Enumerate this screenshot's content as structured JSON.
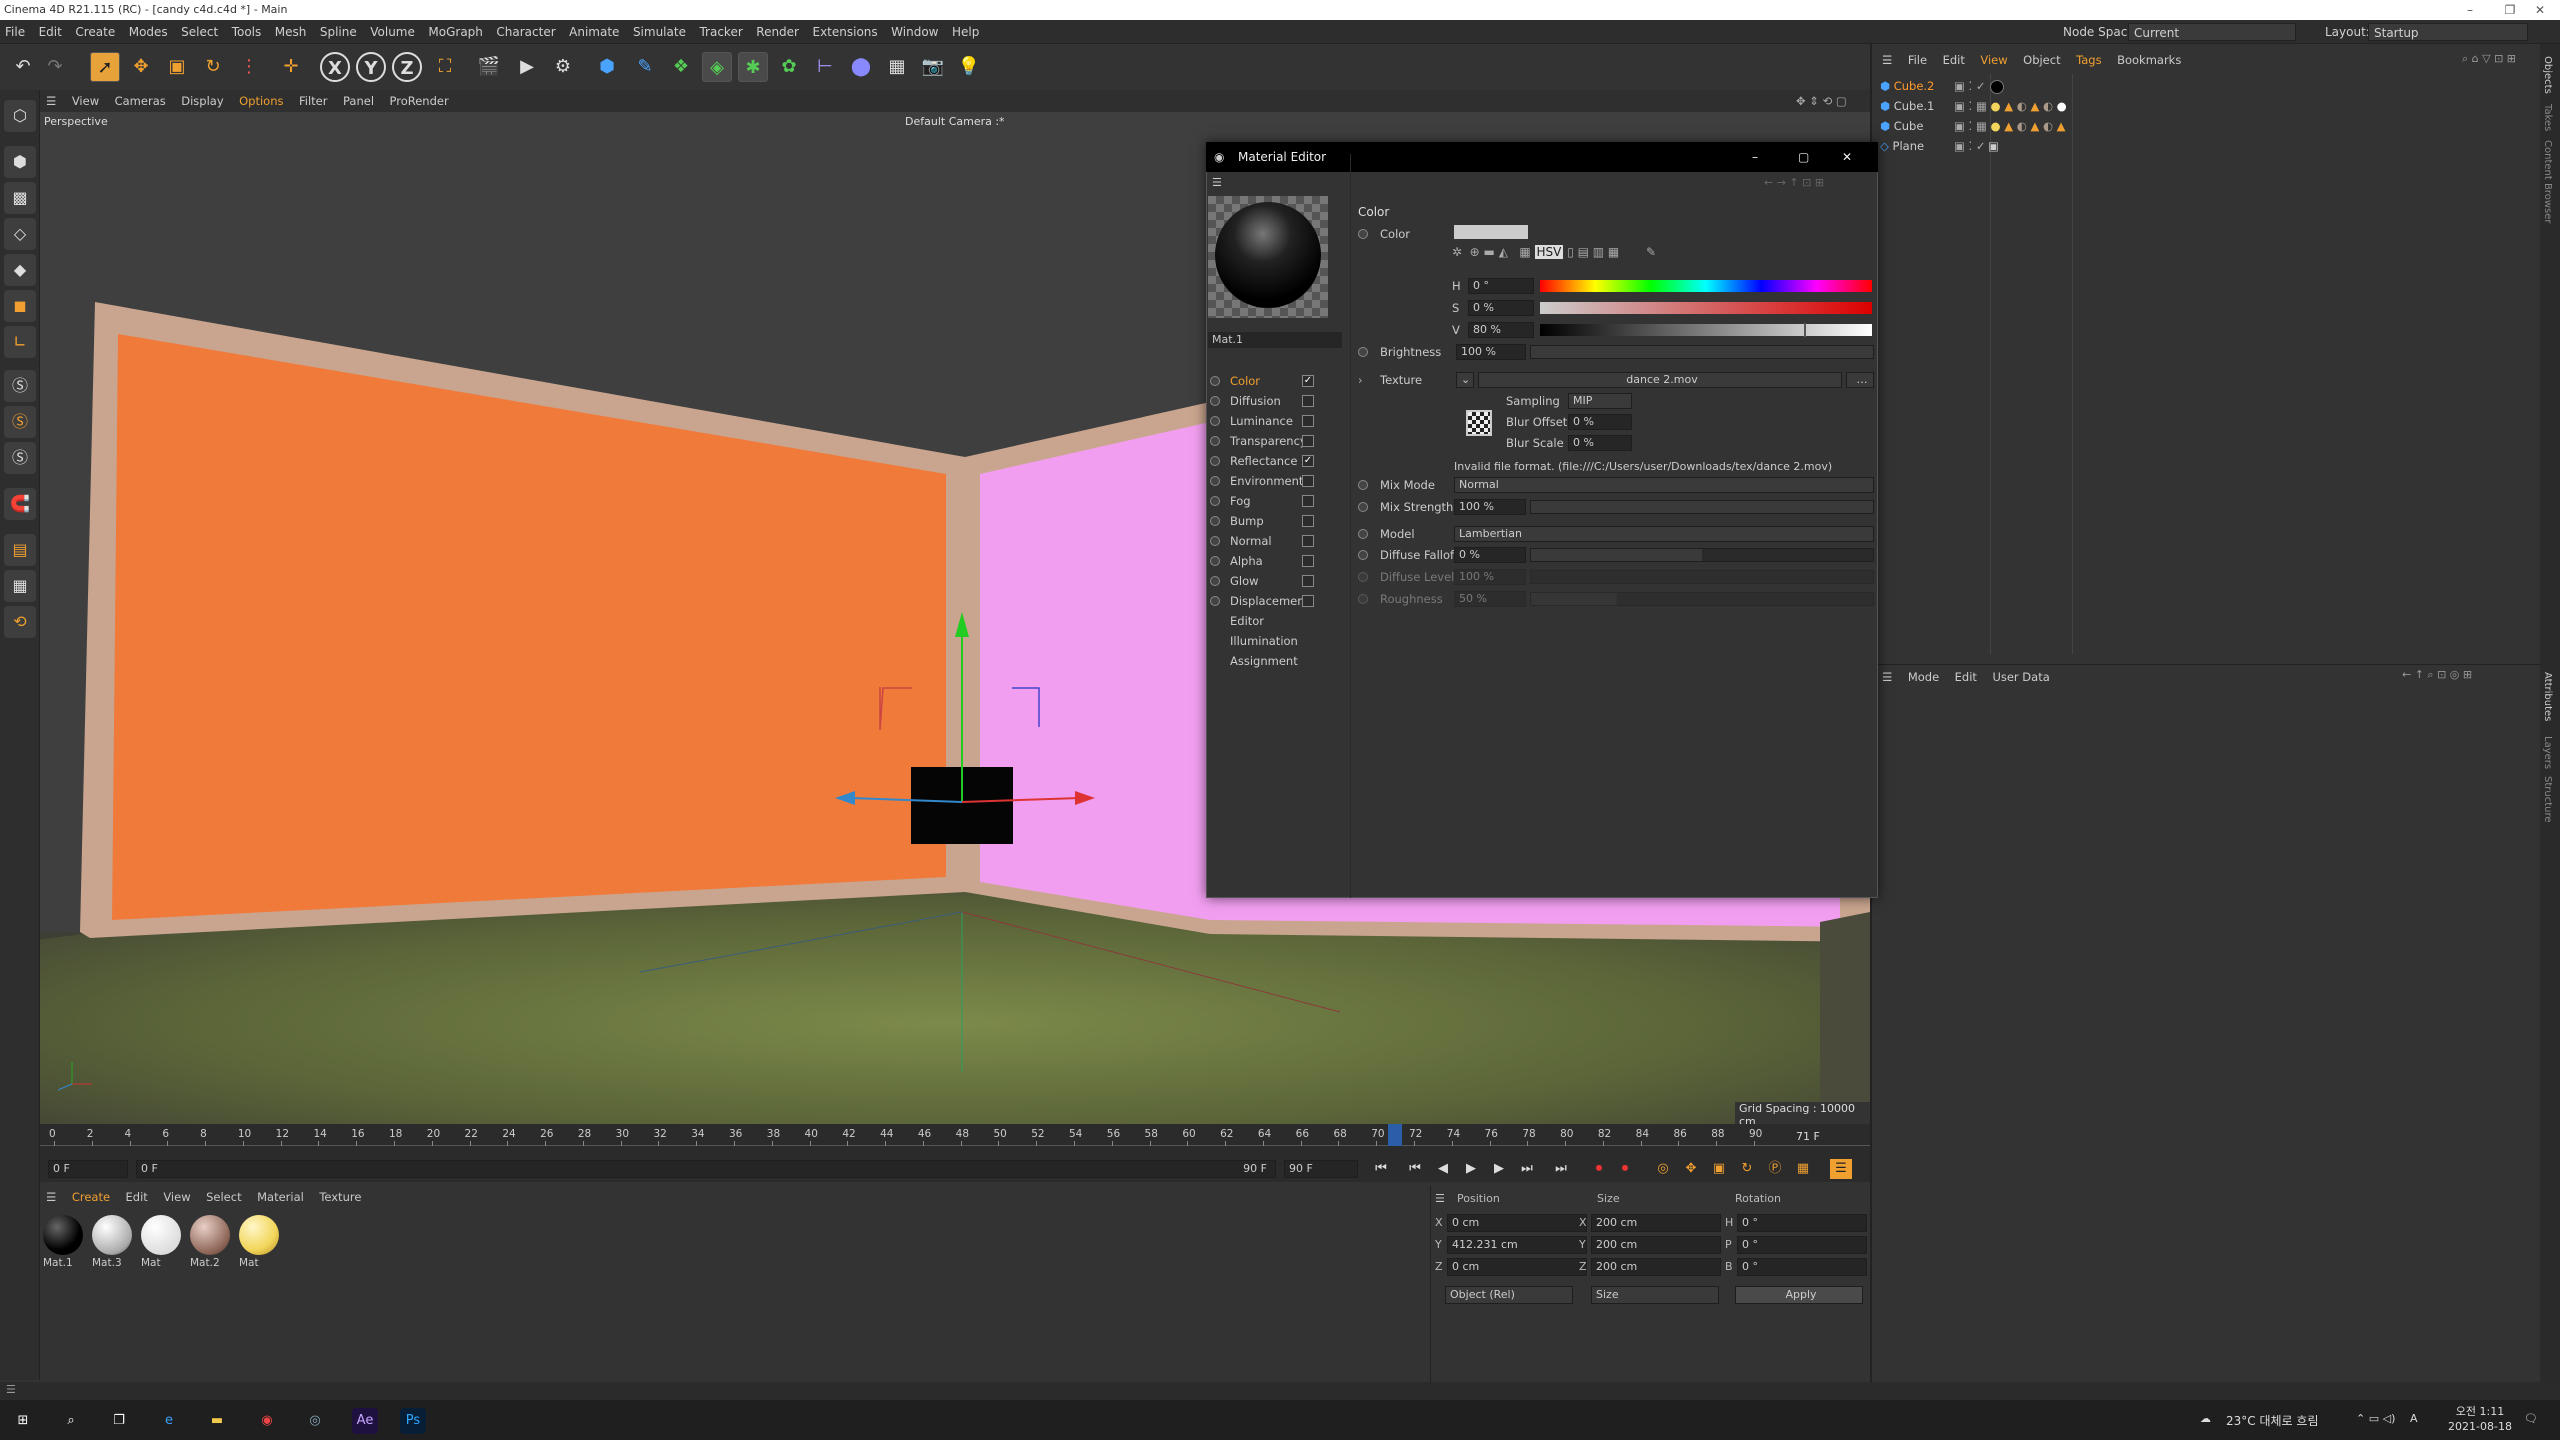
{
  "titlebar": {
    "title": "Cinema 4D R21.115 (RC) - [candy c4d.c4d *] - Main",
    "minimize": "–",
    "restore": "❐",
    "close": "✕"
  },
  "menubar": [
    "File",
    "Edit",
    "Create",
    "Modes",
    "Select",
    "Tools",
    "Mesh",
    "Spline",
    "Volume",
    "MoGraph",
    "Character",
    "Animate",
    "Simulate",
    "Tracker",
    "Render",
    "Extensions",
    "Window",
    "Help"
  ],
  "nodespace": {
    "label": "Node Space:",
    "value": "Current (Standard/Physical)"
  },
  "layout": {
    "label": "Layout:",
    "value": "Startup"
  },
  "toolbar": {
    "x": "X",
    "y": "Y",
    "z": "Z"
  },
  "viewport": {
    "menu": [
      "View",
      "Cameras",
      "Display",
      "Options",
      "Filter",
      "Panel",
      "ProRender"
    ],
    "name": "Perspective",
    "camera": "Default Camera :*",
    "grid_spacing": "Grid Spacing : 10000 cm",
    "colors": {
      "orange_wall": "#f07a3a",
      "pink_wall": "#f29ef0",
      "floor": "#5e6a38",
      "frame": "#c9a58f"
    }
  },
  "timeline": {
    "ticks": [
      "0",
      "2",
      "4",
      "6",
      "8",
      "10",
      "12",
      "14",
      "16",
      "18",
      "20",
      "22",
      "24",
      "26",
      "28",
      "30",
      "32",
      "34",
      "36",
      "38",
      "40",
      "42",
      "44",
      "46",
      "48",
      "50",
      "52",
      "54",
      "56",
      "58",
      "60",
      "62",
      "64",
      "66",
      "68",
      "70",
      "72",
      "74",
      "76",
      "78",
      "80",
      "82",
      "84",
      "86",
      "88",
      "90"
    ],
    "current": "71 F",
    "playhead": 71,
    "max": 90,
    "start_field": "0 F",
    "start_field2": "0 F",
    "end_field": "90 F",
    "end_field2": "90 F"
  },
  "materials": {
    "menu": [
      "Create",
      "Edit",
      "View",
      "Select",
      "Material",
      "Texture"
    ],
    "items": [
      {
        "name": "Mat.1",
        "color": "#111111"
      },
      {
        "name": "Mat.3",
        "color": "#e0e0e0"
      },
      {
        "name": "Mat",
        "color": "#f4f4f4"
      },
      {
        "name": "Mat.2",
        "color": "#9c7a6c"
      },
      {
        "name": "Mat",
        "color": "#f2d55a"
      }
    ]
  },
  "coords": {
    "headers": {
      "position": "Position",
      "size": "Size",
      "rotation": "Rotation"
    },
    "rows": [
      {
        "axis": "X",
        "pos": "0 cm",
        "saxis": "X",
        "size": "200 cm",
        "raxis": "H",
        "rot": "0 °"
      },
      {
        "axis": "Y",
        "pos": "412.231 cm",
        "saxis": "Y",
        "size": "200 cm",
        "raxis": "P",
        "rot": "0 °"
      },
      {
        "axis": "Z",
        "pos": "0 cm",
        "saxis": "Z",
        "size": "200 cm",
        "raxis": "B",
        "rot": "0 °"
      }
    ],
    "mode": "Object (Rel)",
    "size_mode": "Size",
    "apply": "Apply"
  },
  "objects": {
    "menu": [
      "File",
      "Edit",
      "View",
      "Object",
      "Tags",
      "Bookmarks"
    ],
    "items": [
      {
        "name": "Cube.2",
        "color": "#ff9a2a"
      },
      {
        "name": "Cube.1",
        "color": "#ccc"
      },
      {
        "name": "Cube",
        "color": "#ccc"
      },
      {
        "name": "Plane",
        "color": "#ccc"
      }
    ]
  },
  "attributes": {
    "menu": [
      "Mode",
      "Edit",
      "User Data"
    ]
  },
  "right_tabs": [
    "Objects",
    "Takes",
    "Content Browser",
    "Attributes",
    "Layers",
    "Structure"
  ],
  "mat_editor": {
    "title": "Material Editor",
    "mat_name": "Mat.1",
    "channels": [
      {
        "name": "Color",
        "checked": true,
        "active": true
      },
      {
        "name": "Diffusion",
        "checked": false
      },
      {
        "name": "Luminance",
        "checked": false
      },
      {
        "name": "Transparency",
        "checked": false
      },
      {
        "name": "Reflectance",
        "checked": true
      },
      {
        "name": "Environment",
        "checked": false
      },
      {
        "name": "Fog",
        "checked": false
      },
      {
        "name": "Bump",
        "checked": false
      },
      {
        "name": "Normal",
        "checked": false
      },
      {
        "name": "Alpha",
        "checked": false
      },
      {
        "name": "Glow",
        "checked": false
      },
      {
        "name": "Displacement",
        "checked": false
      }
    ],
    "extra": [
      "Editor",
      "Illumination",
      "Assignment"
    ],
    "section": "Color",
    "color_label": "Color",
    "h_label": "H",
    "h": "0 °",
    "s_label": "S",
    "s": "0 %",
    "v_label": "V",
    "v": "80 %",
    "v_level": 0.8,
    "brightness_label": "Brightness",
    "brightness": "100 %",
    "texture_label": "Texture",
    "texture": "dance 2.mov",
    "sampling_label": "Sampling",
    "sampling": "MIP",
    "blur_offset_label": "Blur Offset",
    "blur_offset": "0 %",
    "blur_scale_label": "Blur Scale",
    "blur_scale": "0 %",
    "invalid": "Invalid file format. (file:///C:/Users/user/Downloads/tex/dance 2.mov)",
    "mix_mode_label": "Mix Mode",
    "mix_mode": "Normal",
    "mix_strength_label": "Mix Strength",
    "mix_strength": "100 %",
    "model_label": "Model",
    "model": "Lambertian",
    "diffuse_falloff_label": "Diffuse Falloff",
    "diffuse_falloff": "0 %",
    "diffuse_level_label": "Diffuse Level",
    "diffuse_level": "100 %",
    "roughness_label": "Roughness",
    "roughness": "50 %"
  },
  "taskbar": {
    "weather": "23°C 대체로 흐림",
    "time": "오전 1:11",
    "date": "2021-08-18",
    "lang": "A",
    "ae": "Ae",
    "ps": "Ps"
  }
}
